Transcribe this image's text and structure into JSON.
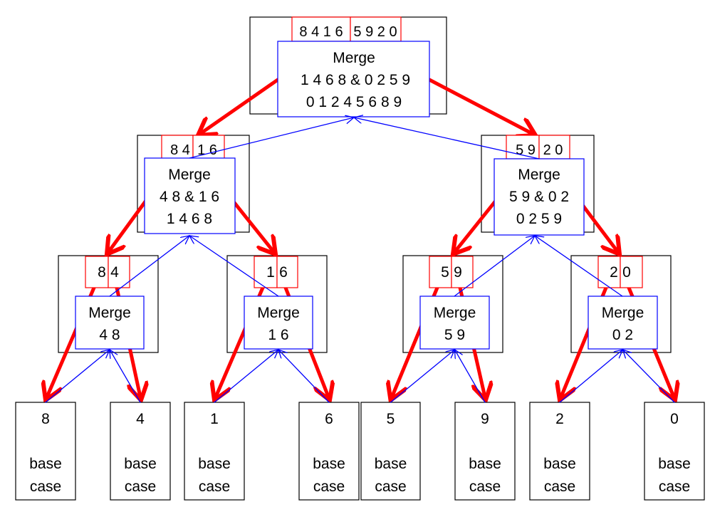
{
  "colors": {
    "split": "#ff0000",
    "merge": "#0000ff",
    "frame": "#000000"
  },
  "top": {
    "left": "8 4 1 6",
    "right": "5 9 2 0",
    "merge_title": "Merge",
    "merge_inputs": "1 4 6 8  & 0 2 5 9",
    "merge_result": "0 1 2 4 5 6 8 9"
  },
  "level2": [
    {
      "left": "8 4",
      "right": "1 6",
      "merge_title": "Merge",
      "merge_inputs": "4 8  & 1 6",
      "merge_result": "1 4 6 8"
    },
    {
      "left": "5 9",
      "right": "2 0",
      "merge_title": "Merge",
      "merge_inputs": "5 9  & 0 2",
      "merge_result": "0 2 5 9"
    }
  ],
  "level3": [
    {
      "left": "8",
      "right": "4",
      "merge_title": "Merge",
      "merge_result": "4 8"
    },
    {
      "left": "1",
      "right": "6",
      "merge_title": "Merge",
      "merge_result": "1 6"
    },
    {
      "left": "5",
      "right": "9",
      "merge_title": "Merge",
      "merge_result": "5 9"
    },
    {
      "left": "2",
      "right": "0",
      "merge_title": "Merge",
      "merge_result": "0 2"
    }
  ],
  "leaves": [
    {
      "value": "8",
      "line1": "base",
      "line2": "case"
    },
    {
      "value": "4",
      "line1": "base",
      "line2": "case"
    },
    {
      "value": "1",
      "line1": "base",
      "line2": "case"
    },
    {
      "value": "6",
      "line1": "base",
      "line2": "case"
    },
    {
      "value": "5",
      "line1": "base",
      "line2": "case"
    },
    {
      "value": "9",
      "line1": "base",
      "line2": "case"
    },
    {
      "value": "2",
      "line1": "base",
      "line2": "case"
    },
    {
      "value": "0",
      "line1": "base",
      "line2": "case"
    }
  ]
}
